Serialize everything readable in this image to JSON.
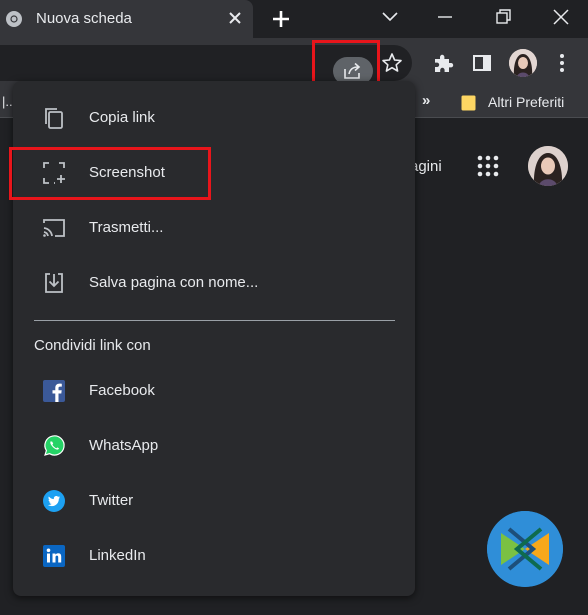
{
  "tab": {
    "title": "Nuova scheda"
  },
  "bookmarks": {
    "left_label": "|..",
    "more": "»",
    "other_label": "Altri Preferiti"
  },
  "page": {
    "partial_text": "agini"
  },
  "share_menu": {
    "items": [
      {
        "label": "Copia link",
        "icon": "copy-icon"
      },
      {
        "label": "Screenshot",
        "icon": "screenshot-icon"
      },
      {
        "label": "Trasmetti...",
        "icon": "cast-icon"
      },
      {
        "label": "Salva pagina con nome...",
        "icon": "save-page-icon"
      }
    ],
    "section_title": "Condividi link con",
    "targets": [
      {
        "label": "Facebook",
        "icon": "facebook-icon"
      },
      {
        "label": "WhatsApp",
        "icon": "whatsapp-icon"
      },
      {
        "label": "Twitter",
        "icon": "twitter-icon"
      },
      {
        "label": "LinkedIn",
        "icon": "linkedin-icon"
      }
    ]
  },
  "colors": {
    "highlight": "#e8151b",
    "menu_bg": "#292a2d",
    "toolbar_bg": "#35363a",
    "facebook": "#3b5998",
    "whatsapp": "#25d366",
    "twitter": "#1da1f2",
    "linkedin": "#0a66c2"
  }
}
